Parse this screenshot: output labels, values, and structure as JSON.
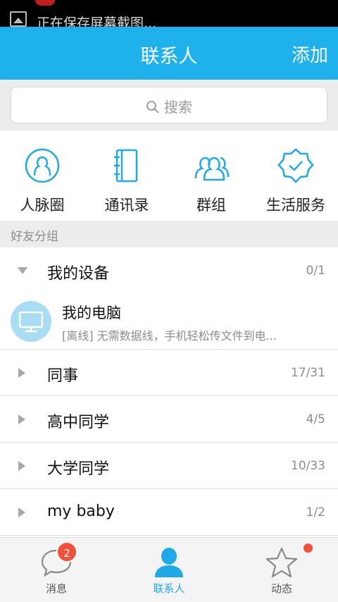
{
  "status_bar": {
    "notification": "正在保存屏幕截图..."
  },
  "header": {
    "title": "联系人",
    "add_label": "添加"
  },
  "search": {
    "placeholder": "搜索"
  },
  "quick_entries": [
    {
      "label": "人脉圈",
      "icon": "person-circle-icon"
    },
    {
      "label": "通讯录",
      "icon": "address-book-icon"
    },
    {
      "label": "群组",
      "icon": "group-icon"
    },
    {
      "label": "生活服务",
      "icon": "service-badge-icon"
    }
  ],
  "friends_section": {
    "label": "好友分组"
  },
  "groups": [
    {
      "name": "我的设备",
      "count": "0/1",
      "expanded": true
    },
    {
      "name": "同事",
      "count": "17/31",
      "expanded": false
    },
    {
      "name": "高中同学",
      "count": "4/5",
      "expanded": false
    },
    {
      "name": "大学同学",
      "count": "10/33",
      "expanded": false
    },
    {
      "name": "my baby",
      "count": "1/2",
      "expanded": false
    }
  ],
  "device": {
    "name": "我的电脑",
    "description": "[离线] 无需数据线，手机轻松传文件到电..."
  },
  "tabs": [
    {
      "label": "消息",
      "badge": "2",
      "icon": "chat-bubble-icon"
    },
    {
      "label": "联系人",
      "icon": "contact-person-icon",
      "active": true
    },
    {
      "label": "动态",
      "icon": "star-icon",
      "dot": true
    }
  ],
  "colors": {
    "accent": "#1fb1ec",
    "badge": "#f2503b",
    "active_tab": "#1fa9e6"
  }
}
